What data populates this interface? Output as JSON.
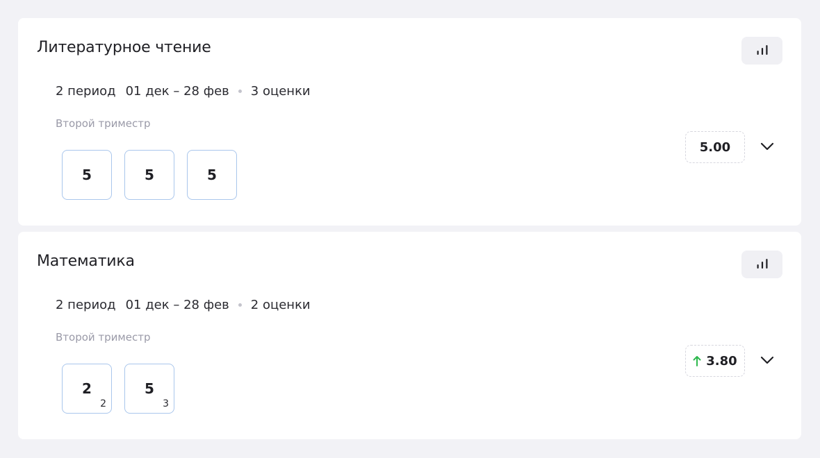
{
  "subjects": [
    {
      "title": "Литературное чтение",
      "period": "2 период",
      "dates": "01 дек – 28 фев",
      "marks_count": "3 оценки",
      "term": "Второй триместр",
      "grades": [
        {
          "value": "5",
          "weight": ""
        },
        {
          "value": "5",
          "weight": ""
        },
        {
          "value": "5",
          "weight": ""
        }
      ],
      "average": "5.00",
      "trend": "none",
      "chart_button_icon": "bar-chart-icon",
      "expand_icon": "chevron-down-icon"
    },
    {
      "title": "Математика",
      "period": "2 период",
      "dates": "01 дек – 28 фев",
      "marks_count": "2 оценки",
      "term": "Второй триместр",
      "grades": [
        {
          "value": "2",
          "weight": "2"
        },
        {
          "value": "5",
          "weight": "3"
        }
      ],
      "average": "3.80",
      "trend": "up",
      "chart_button_icon": "bar-chart-icon",
      "expand_icon": "chevron-down-icon"
    }
  ],
  "colors": {
    "background": "#f2f2f6",
    "card": "#ffffff",
    "grade_border": "#a9c6ec",
    "trend_up": "#2db84d",
    "muted_text": "#9a9aa8"
  }
}
